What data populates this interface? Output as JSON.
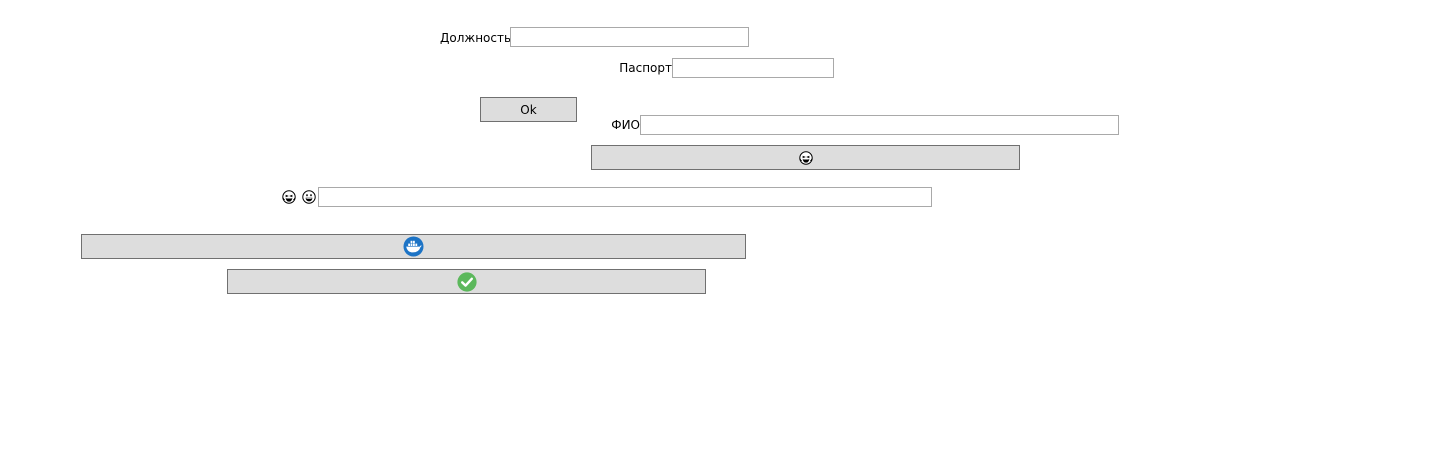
{
  "form": {
    "position_label": "Должность",
    "position_value": "",
    "passport_label": "Паспорт",
    "passport_value": "",
    "ok_label": "Ok",
    "fio_label": "ФИО",
    "fio_value": "",
    "emoji_row_value": ""
  },
  "icons": {
    "laugh_button_icon": "grinning-squint-tears-icon",
    "emoji_row_icons": [
      "grinning-squint-tears-icon",
      "grinning-face-icon"
    ],
    "docker_button_icon": "docker-icon",
    "check_button_icon": "check-circle-icon"
  },
  "colors": {
    "button_bg": "#dddddd",
    "button_border": "#707070",
    "field_border": "#a9a9a9",
    "docker_blue": "#1d74c6",
    "check_green": "#5cb85c"
  }
}
